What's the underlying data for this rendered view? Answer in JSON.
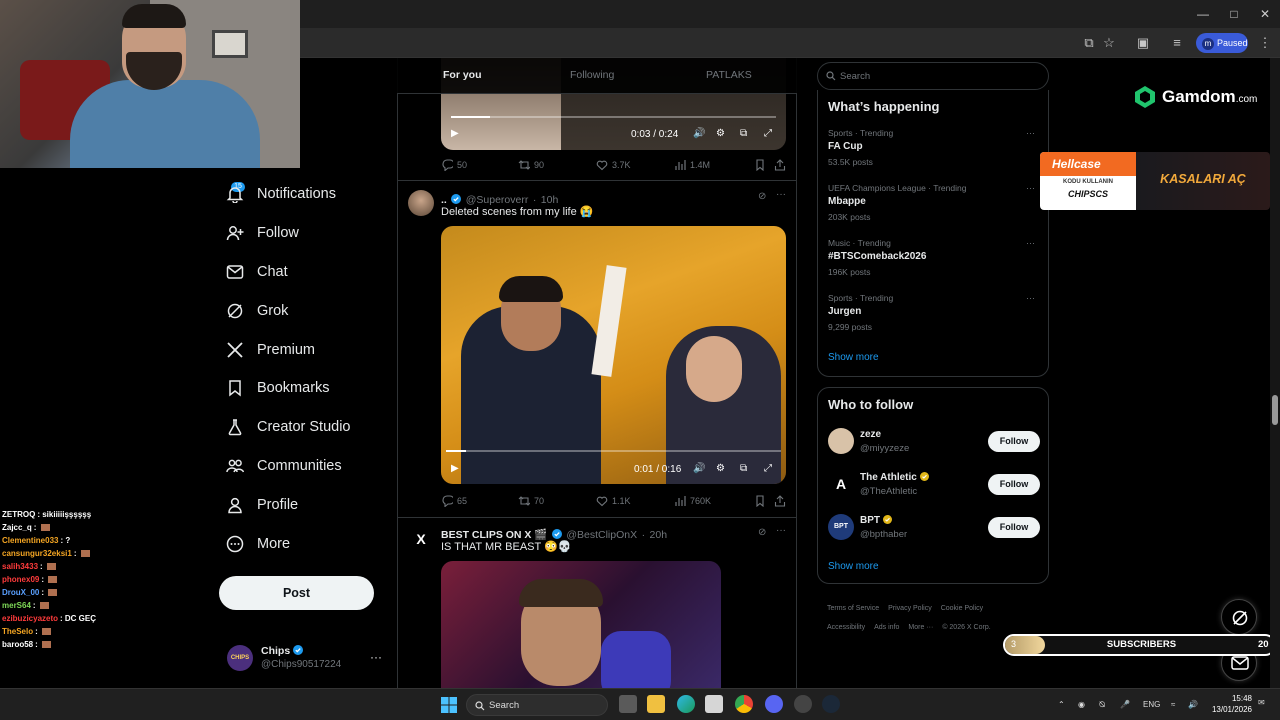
{
  "browser": {
    "profile_initial": "m",
    "profile_status": "Paused"
  },
  "chat": [
    {
      "user": "ZETROQ",
      "color": "#ffffff",
      "msg": "sikiiiiişşşşşş"
    },
    {
      "user": "Zajcc_q",
      "color": "#ffffff",
      "msg": ""
    },
    {
      "user": "Clementine033",
      "color": "#f5a623",
      "msg": "?"
    },
    {
      "user": "cansungur32eksi1",
      "color": "#f5a623",
      "msg": ""
    },
    {
      "user": "salih3433",
      "color": "#ff3b3b",
      "msg": ""
    },
    {
      "user": "phonex09",
      "color": "#ff3b3b",
      "msg": ""
    },
    {
      "user": "DrouX_00",
      "color": "#5aa0ff",
      "msg": ""
    },
    {
      "user": "merS64",
      "color": "#7ed957",
      "msg": ""
    },
    {
      "user": "ezibuzicyazeto",
      "color": "#ff3b3b",
      "msg": "DC GEÇ"
    },
    {
      "user": "TheSelo",
      "color": "#f5a623",
      "msg": ""
    },
    {
      "user": "baroo58",
      "color": "#ffffff",
      "msg": ""
    }
  ],
  "nav": {
    "notifications_badge": "15",
    "items": [
      {
        "label": "Notifications",
        "icon": "bell-icon"
      },
      {
        "label": "Follow",
        "icon": "person-plus-icon"
      },
      {
        "label": "Chat",
        "icon": "envelope-icon"
      },
      {
        "label": "Grok",
        "icon": "grok-icon"
      },
      {
        "label": "Premium",
        "icon": "x-logo-icon"
      },
      {
        "label": "Bookmarks",
        "icon": "bookmark-icon"
      },
      {
        "label": "Creator Studio",
        "icon": "flask-icon"
      },
      {
        "label": "Communities",
        "icon": "people-icon"
      },
      {
        "label": "Profile",
        "icon": "person-icon"
      },
      {
        "label": "More",
        "icon": "more-circle-icon"
      }
    ],
    "post_label": "Post",
    "account": {
      "name": "Chips",
      "handle": "@Chips90517224",
      "avatar_text": "CHIPS"
    }
  },
  "tabs": [
    {
      "label": "For you",
      "active": true
    },
    {
      "label": "Following",
      "active": false
    },
    {
      "label": "PATLAKS",
      "active": false
    }
  ],
  "posts": [
    {
      "video_time": "0:03 / 0:24",
      "video_progress": 0.12,
      "stats": {
        "replies": "50",
        "reposts": "90",
        "likes": "3.7K",
        "views": "1.4M"
      }
    },
    {
      "display_name": "..",
      "handle": "@Superoverr",
      "time": "10h",
      "text": "Deleted scenes from my life 😭",
      "video_time": "0:01 / 0:16",
      "video_progress": 0.06,
      "stats": {
        "replies": "65",
        "reposts": "70",
        "likes": "1.1K",
        "views": "760K"
      }
    },
    {
      "display_name": "BEST CLIPS ON X 🎬",
      "handle": "@BestClipOnX",
      "time": "20h",
      "text": "IS THAT MR BEAST 😳💀"
    }
  ],
  "sidebar": {
    "search_placeholder": "Search",
    "whats_happening_title": "What’s happening",
    "trends": [
      {
        "category": "Sports · Trending",
        "name": "FA Cup",
        "posts": "53.5K posts"
      },
      {
        "category": "UEFA Champions League · Trending",
        "name": "Mbappe",
        "posts": "203K posts"
      },
      {
        "category": "Music · Trending",
        "name": "#BTSComeback2026",
        "posts": "196K posts"
      },
      {
        "category": "Sports · Trending",
        "name": "Jurgen",
        "posts": "9,299 posts"
      }
    ],
    "show_more": "Show more",
    "who_to_follow_title": "Who to follow",
    "suggestions": [
      {
        "name": "zeze",
        "handle": "@miyyzeze",
        "verified": false,
        "avatar_color": "#d8c2a8"
      },
      {
        "name": "The Athletic",
        "handle": "@TheAthletic",
        "verified": true,
        "avatar_color": "#000000",
        "avatar_text": "A"
      },
      {
        "name": "BPT",
        "handle": "@bpthaber",
        "verified": true,
        "avatar_color": "#1f3b7a",
        "avatar_text": "BPT"
      }
    ],
    "follow_label": "Follow",
    "footer": [
      "Terms of Service",
      "Privacy Policy",
      "Cookie Policy",
      "Accessibility",
      "Ads info",
      "More ···",
      "© 2026 X Corp."
    ]
  },
  "overlay": {
    "gamdom": {
      "name": "Gamdom",
      "tld": ".com"
    },
    "hellcase": {
      "brand": "Hellcase",
      "sub": "KODU KULLANIN",
      "code": "CHIPSCS",
      "cta": "KASALARI AÇ"
    },
    "subs": {
      "current": "3",
      "label": "SUBSCRIBERS",
      "goal": "20",
      "fraction": 0.15
    }
  },
  "taskbar": {
    "search_label": "Search",
    "lang": "ENG",
    "time": "15:48",
    "date": "13/01/2026"
  },
  "colors": {
    "accent": "#1d9bf0",
    "verified": "#1d9bf0",
    "gold_verified": "#e2b719"
  }
}
